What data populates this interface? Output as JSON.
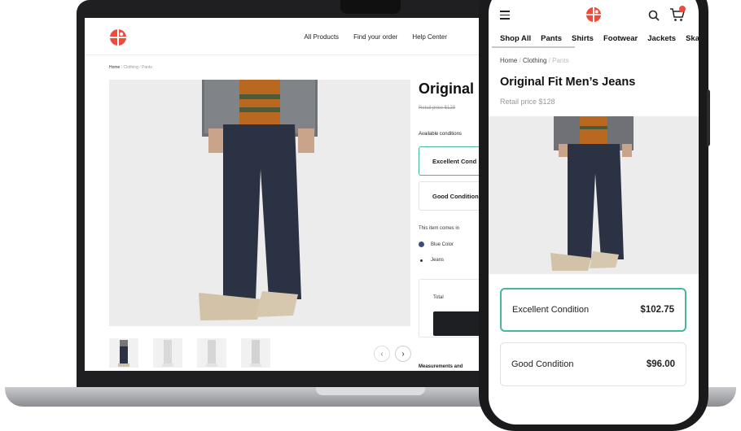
{
  "colors": {
    "accent": "#47b59f",
    "brand": "#ef4b3a",
    "dark": "#1d1f22",
    "jeans": "#2a3243"
  },
  "desktop": {
    "nav": {
      "all_products": "All Products",
      "find_order": "Find your order",
      "help_center": "Help Center"
    },
    "breadcrumb": {
      "home": "Home",
      "sep1": "/",
      "clothing": "Clothing",
      "sep2": "/",
      "pants": "Pants"
    },
    "product": {
      "title": "Original",
      "retail": "Retail price $128",
      "available_label": "Available conditions",
      "conditions": [
        {
          "label": "Excellent Cond"
        },
        {
          "label": "Good Condition"
        }
      ],
      "comes_in_label": "This item comes in",
      "features": [
        {
          "label": "Blue Color",
          "icon": "blue-dot-icon"
        },
        {
          "label": "Jeans",
          "icon": "bullet-icon"
        }
      ],
      "total_label": "Total",
      "measurements_label": "Measurements and"
    }
  },
  "mobile": {
    "categories": [
      "Shop All",
      "Pants",
      "Shirts",
      "Footwear",
      "Jackets",
      "Skatel"
    ],
    "breadcrumb": {
      "home": "Home",
      "sep1": "/",
      "clothing": "Clothing",
      "sep2": "/",
      "pants": "Pants"
    },
    "product": {
      "title": "Original Fit Men’s Jeans",
      "retail": "Retail price $128",
      "conditions": [
        {
          "label": "Excellent Condition",
          "price": "$102.75"
        },
        {
          "label": "Good Condition",
          "price": "$96.00"
        }
      ]
    }
  }
}
